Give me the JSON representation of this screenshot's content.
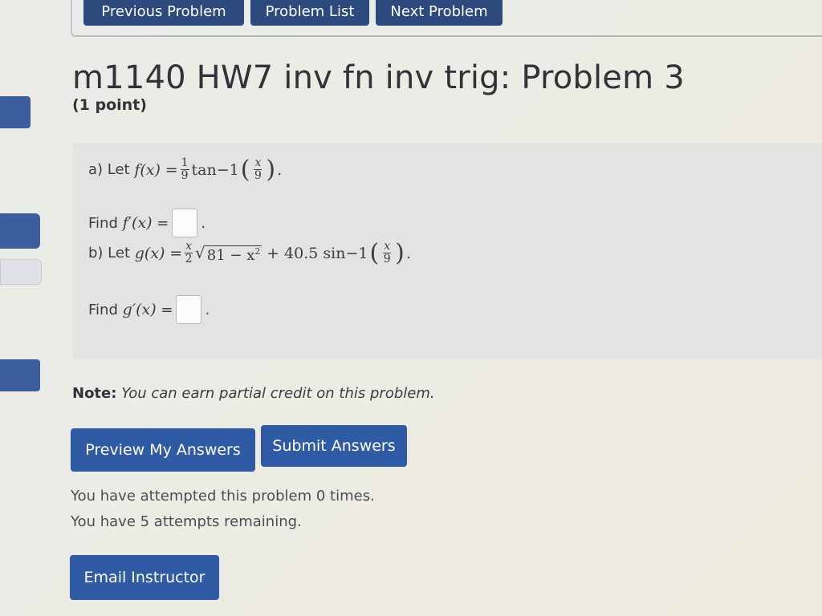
{
  "nav": {
    "previous": "Previous Problem",
    "list": "Problem List",
    "next": "Next Problem"
  },
  "title": "m1140 HW7 inv fn inv trig: Problem 3",
  "points": "(1 point)",
  "problem": {
    "a_prefix": "a) Let",
    "a_func": "f(x)",
    "a_eq": "=",
    "a_frac_num": "1",
    "a_frac_den": "9",
    "a_trig": "tan",
    "a_inv": "−1",
    "a_arg_num": "x",
    "a_arg_den": "9",
    "a_end": ".",
    "find_a_label": "Find",
    "find_a_func": "f′(x)",
    "find_a_eq": "=",
    "find_a_end": ".",
    "b_prefix": "b) Let",
    "b_func": "g(x)",
    "b_eq": "=",
    "b_frac_num": "x",
    "b_frac_den": "2",
    "b_radicand": "81 − x",
    "b_radicand_exp": "2",
    "b_plus": "+ 40.5 sin",
    "b_inv": "−1",
    "b_arg_num": "x",
    "b_arg_den": "9",
    "b_end": ".",
    "find_b_label": "Find",
    "find_b_func": "g′(x)",
    "find_b_eq": "=",
    "find_b_end": "."
  },
  "note_label": "Note:",
  "note_text": "You can earn partial credit on this problem.",
  "buttons": {
    "preview": "Preview My Answers",
    "submit": "Submit Answers",
    "email": "Email Instructor"
  },
  "status": {
    "attempted": "You have attempted this problem 0 times.",
    "remaining": "You have 5 attempts remaining."
  },
  "colors": {
    "nav_button": "#2c4a7d",
    "primary_button": "#2f5ba5",
    "problem_bg": "#e3e4e1"
  }
}
